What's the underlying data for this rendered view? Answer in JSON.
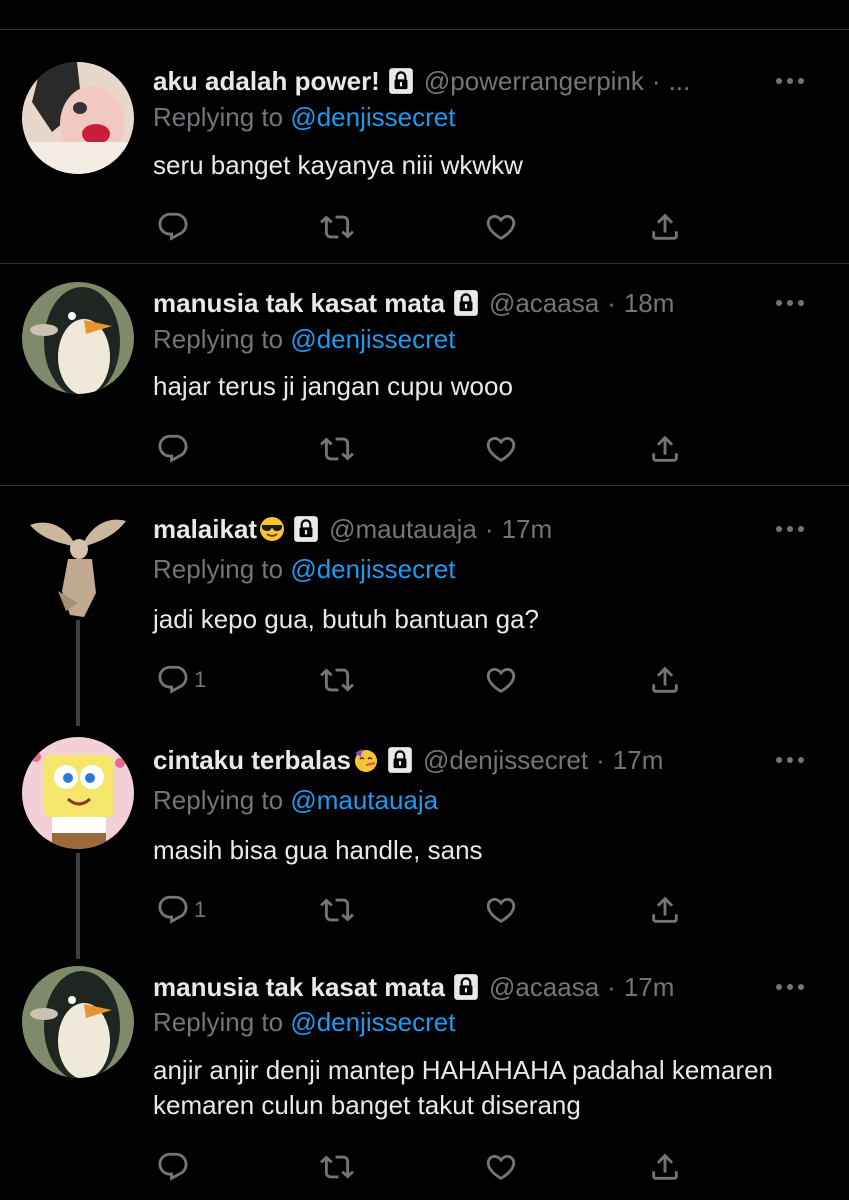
{
  "theme": {
    "background": "#000000",
    "text": "#e7e9ea",
    "secondary": "#71767b",
    "link": "#1d9bf0",
    "divider": "#2f3336"
  },
  "tweets": [
    {
      "name": "aku adalah power!",
      "handle": "@powerrangerpink",
      "time": "...",
      "replying_label": "Replying to",
      "replying_to": "@denjissecret",
      "text": "seru banget kayanya niii wkwkw",
      "reply_count": "",
      "avatar": "pink-face-avatar"
    },
    {
      "name": "manusia tak kasat mata",
      "handle": "@acaasa",
      "time": "18m",
      "replying_label": "Replying to",
      "replying_to": "@denjissecret",
      "text": "hajar terus ji jangan cupu wooo",
      "reply_count": "",
      "avatar": "penguin-avatar"
    },
    {
      "name": "malaikat",
      "name_emoji": "smiling-face-with-sunglasses",
      "handle": "@mautauaja",
      "time": "17m",
      "replying_label": "Replying to",
      "replying_to": "@denjissecret",
      "text": "jadi kepo gua, butuh bantuan ga?",
      "reply_count": "1",
      "avatar": "angel-statue-avatar"
    },
    {
      "name": "cintaku terbalas",
      "name_emoji": "partying-face",
      "handle": "@denjissecret",
      "time": "17m",
      "replying_label": "Replying to",
      "replying_to": "@mautauaja",
      "text": "masih bisa gua handle, sans",
      "reply_count": "1",
      "avatar": "spongebob-avatar"
    },
    {
      "name": "manusia tak kasat mata",
      "handle": "@acaasa",
      "time": "17m",
      "replying_label": "Replying to",
      "replying_to": "@denjissecret",
      "text": "anjir anjir denji mantep HAHAHAHA padahal kemaren kemaren culun banget takut diserang",
      "reply_count": "",
      "avatar": "penguin-avatar"
    }
  ]
}
